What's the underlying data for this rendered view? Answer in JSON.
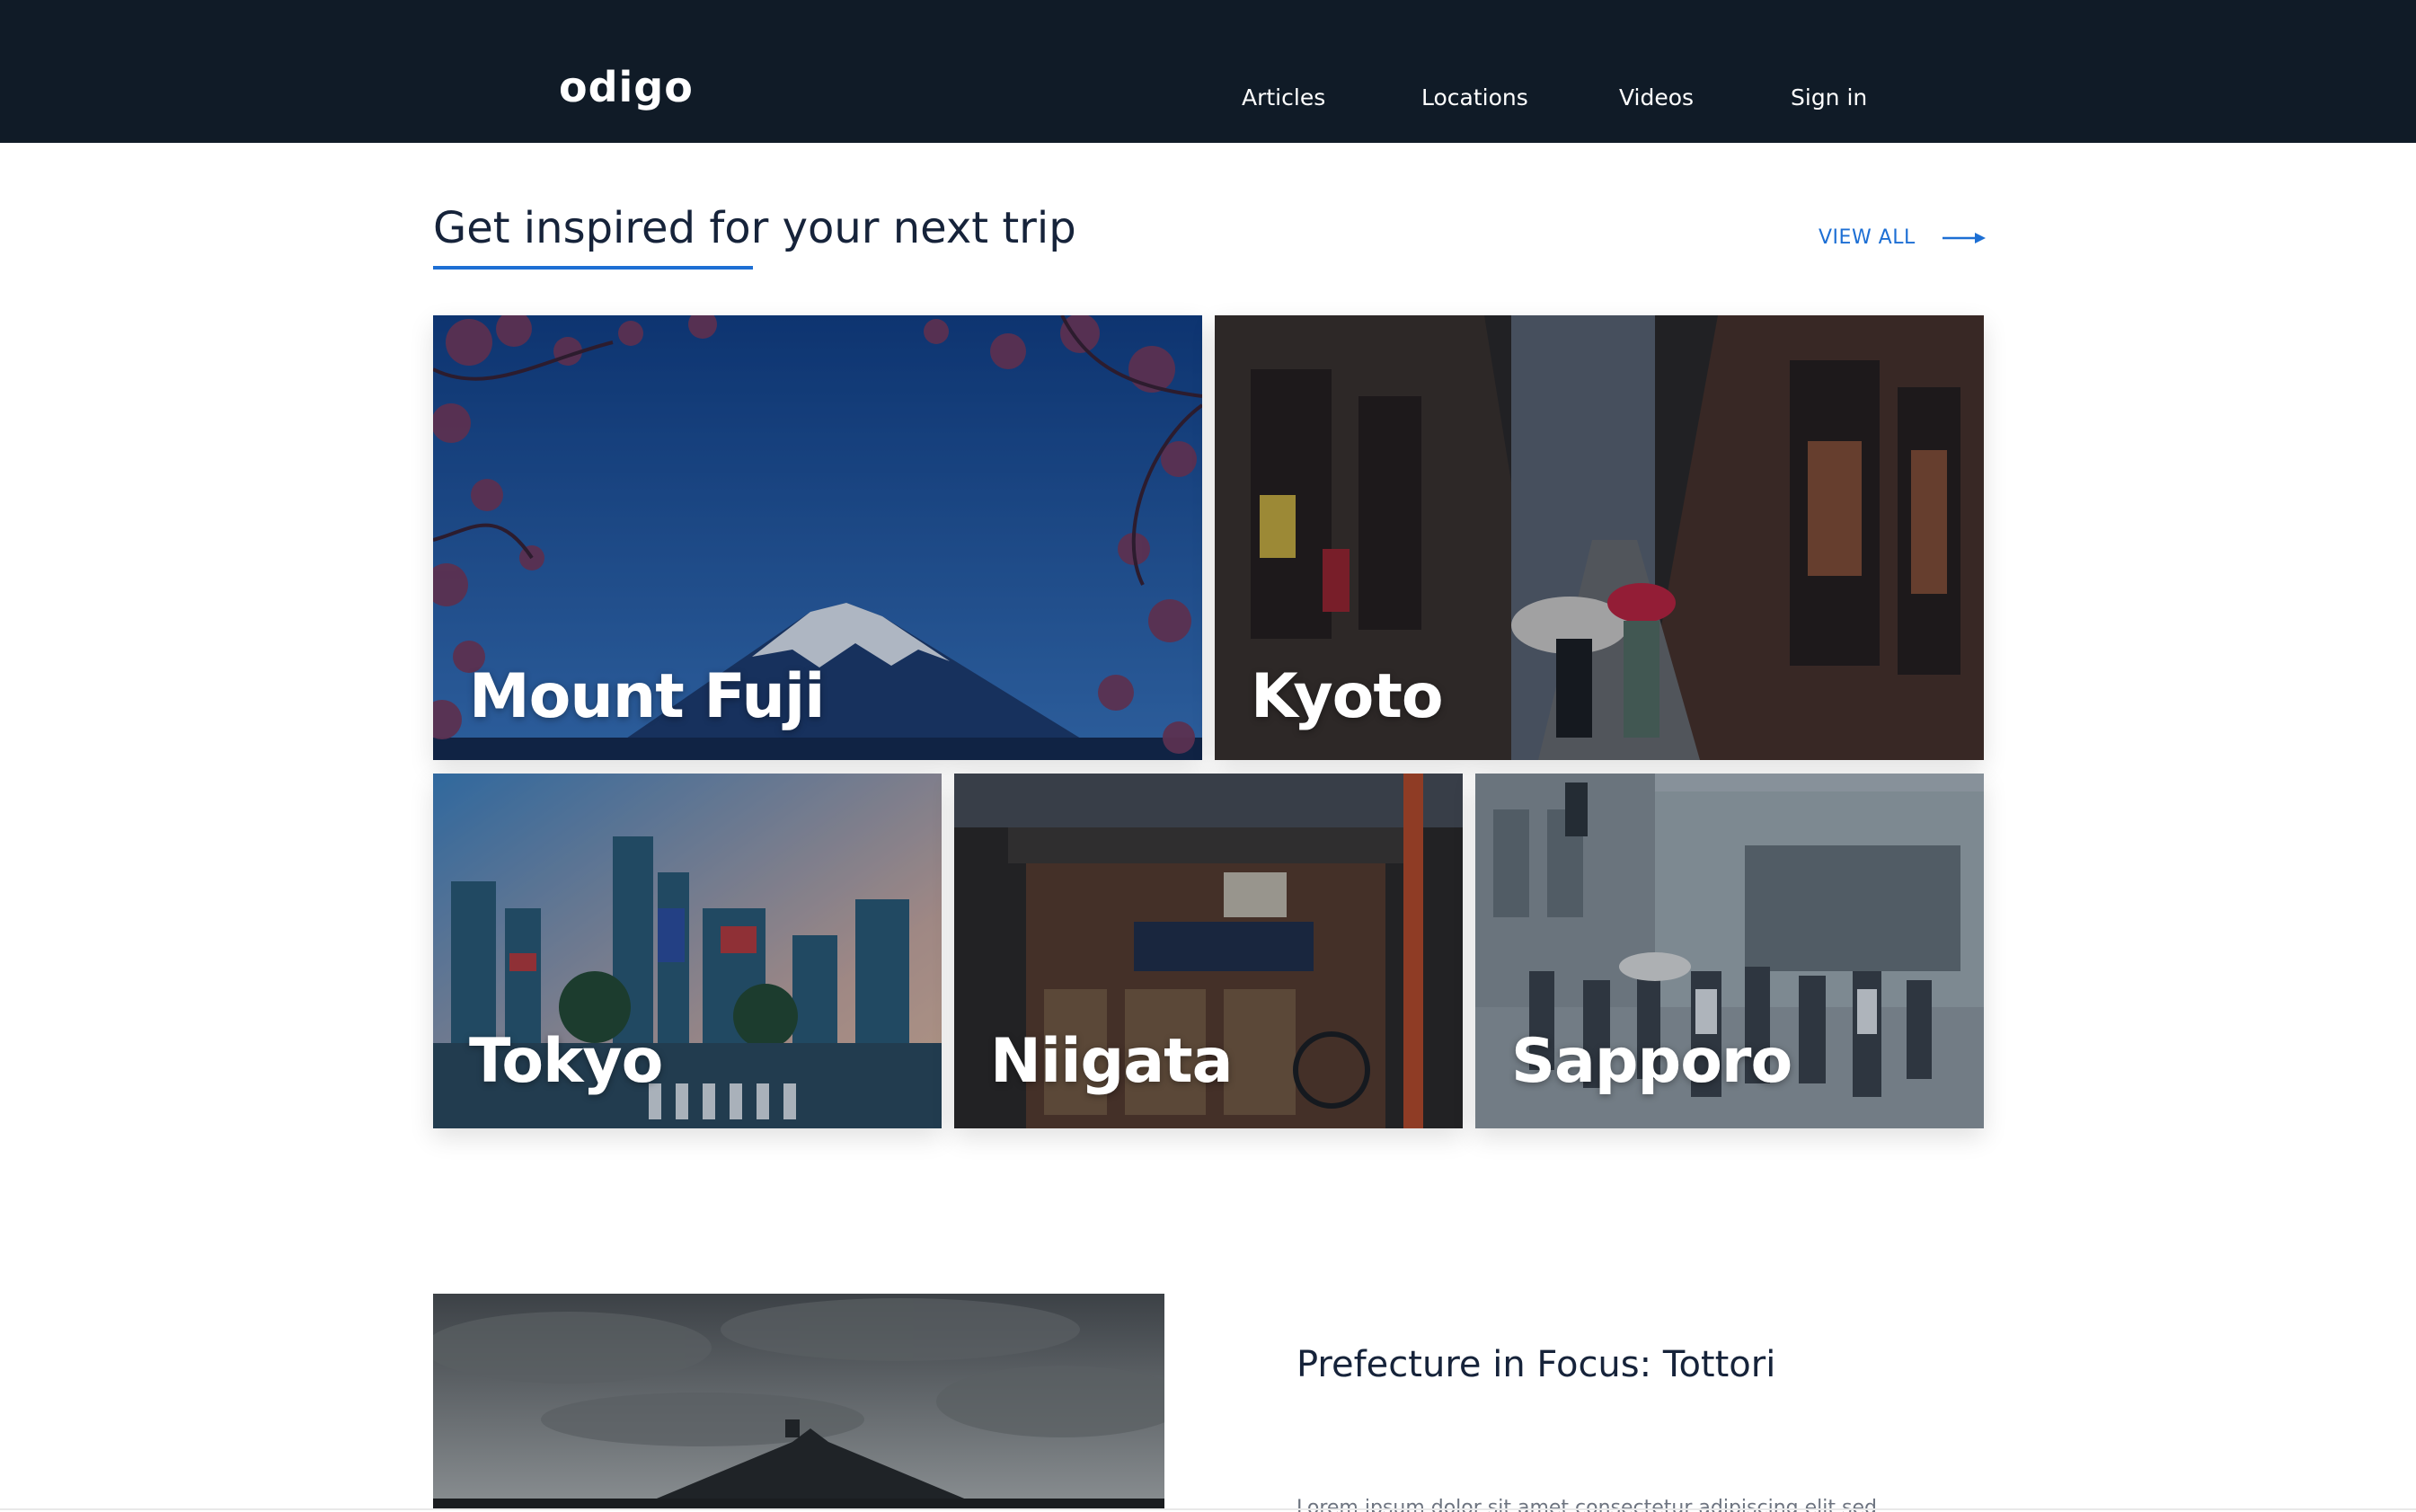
{
  "nav": {
    "logo": "odigo",
    "links": [
      "Articles",
      "Locations",
      "Videos",
      "Sign in"
    ]
  },
  "inspire": {
    "title": "Get inspired for your next trip",
    "view_all": "VIEW ALL",
    "cards": [
      "Mount Fuji",
      "Kyoto",
      "Tokyo",
      "Niigata",
      "Sapporo"
    ]
  },
  "feature": {
    "title": "Prefecture in Focus: Tottori",
    "excerpt": "Lorem ipsum dolor sit amet consectetur adipiscing elit sed do"
  },
  "colors": {
    "navbar": "#101b27",
    "accent": "#1d6fd4",
    "heading": "#16233a"
  }
}
